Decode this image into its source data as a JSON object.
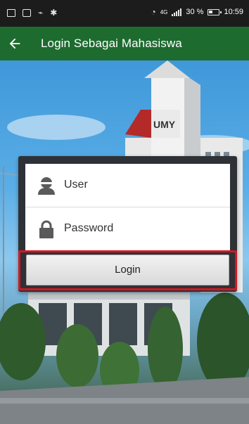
{
  "status_bar": {
    "network_label": "4G",
    "battery_percent": "30 %",
    "time": "10:59",
    "icons": [
      "notification-icon",
      "message-icon",
      "usb-icon",
      "bluetooth-icon",
      "wifi-icon",
      "signal-icon",
      "battery-icon"
    ]
  },
  "app_bar": {
    "title": "Login Sebagai Mahasiswa",
    "back_icon": "arrow-left-icon",
    "color": "#1d6b2f"
  },
  "background": {
    "building_sign": "UMY"
  },
  "login_form": {
    "user_placeholder": "User",
    "password_placeholder": "Password",
    "login_label": "Login",
    "user_icon": "user-icon",
    "password_icon": "lock-icon",
    "highlight_color": "#d5161f"
  }
}
